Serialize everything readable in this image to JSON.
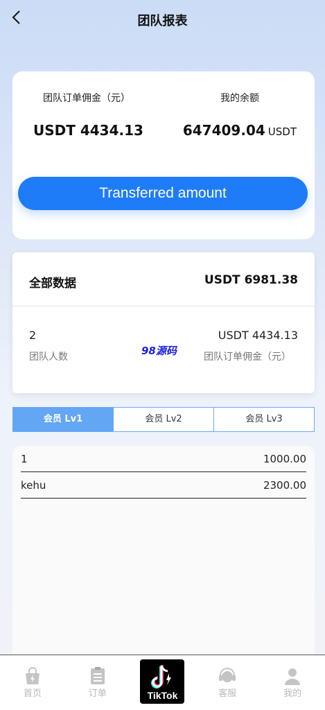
{
  "header": {
    "title": "团队报表"
  },
  "summary": {
    "commission_label": "团队订单佣金（元）",
    "commission_value": "USDT 4434.13",
    "balance_label": "我的余额",
    "balance_value": "647409.04",
    "balance_unit": "USDT",
    "transfer_button": "Transferred amount"
  },
  "all_data": {
    "title": "全部数据",
    "total": "USDT 6981.38",
    "team_count": "2",
    "team_count_label": "团队人数",
    "team_commission": "USDT 4434.13",
    "team_commission_label": "团队订单佣金（元）",
    "watermark": "98源码"
  },
  "tabs": [
    {
      "label": "会员 Lv1",
      "active": true
    },
    {
      "label": "会员 Lv2",
      "active": false
    },
    {
      "label": "会员 Lv3",
      "active": false
    }
  ],
  "members": [
    {
      "name": "1",
      "amount": "1000.00"
    },
    {
      "name": "kehu",
      "amount": "2300.00"
    }
  ],
  "tabbar": {
    "items": [
      {
        "label": "首页",
        "icon": "home-bag-icon"
      },
      {
        "label": "订单",
        "icon": "order-clipboard-icon"
      },
      {
        "label": "TikTok",
        "icon": "tiktok-logo-icon"
      },
      {
        "label": "客服",
        "icon": "headset-icon"
      },
      {
        "label": "我的",
        "icon": "user-icon"
      }
    ]
  },
  "colors": {
    "accent": "#1e7cf8",
    "tab_active": "#62a6f4",
    "watermark": "#1a22e0"
  }
}
